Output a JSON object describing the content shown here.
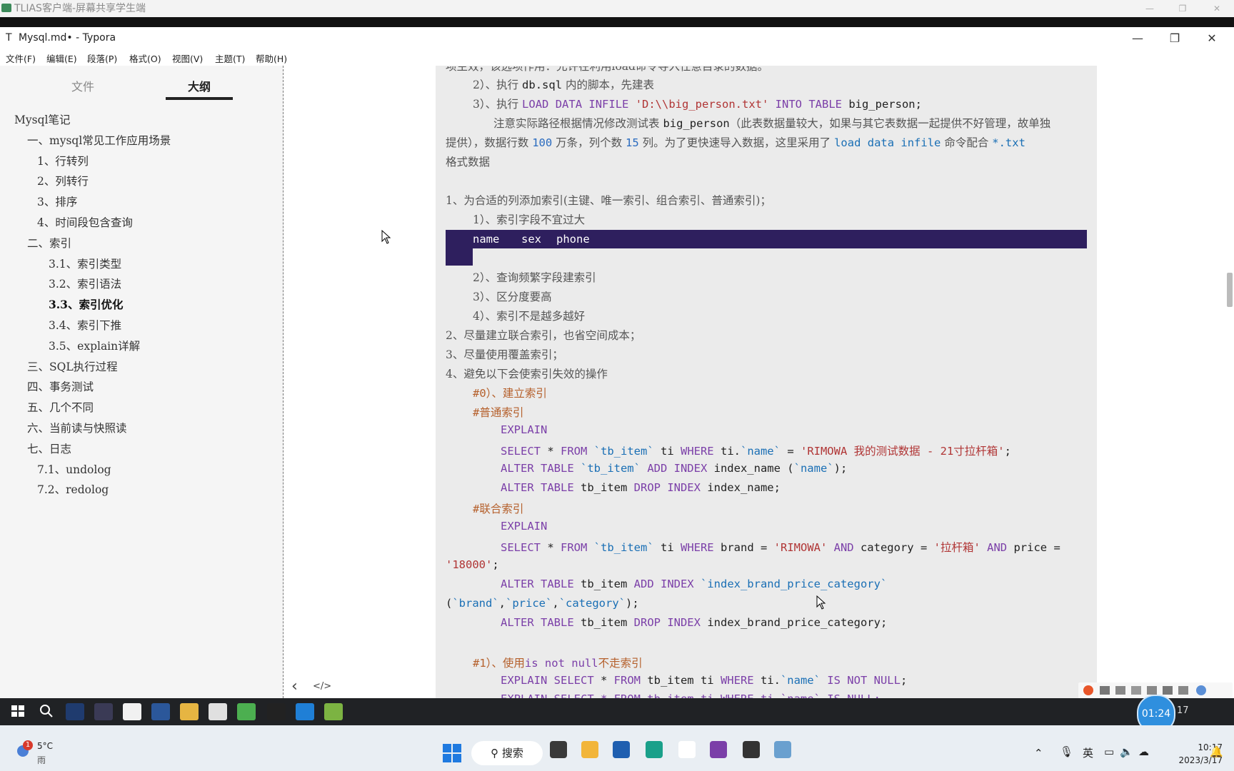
{
  "outer_window": {
    "title": "TLIAS客户端-屏幕共享学生端",
    "controls": [
      "—",
      "❐",
      "✕"
    ]
  },
  "typora": {
    "icon_letter": "T",
    "title": "Mysql.md• - Typora",
    "window_controls": [
      "—",
      "❐",
      "✕"
    ],
    "menu": [
      "文件(F)",
      "编辑(E)",
      "段落(P)",
      "格式(O)",
      "视图(V)",
      "主题(T)",
      "帮助(H)"
    ]
  },
  "sidebar": {
    "tabs": [
      "文件",
      "大纲"
    ],
    "active_tab": "大纲",
    "outline": [
      {
        "text": "Mysql笔记",
        "level": 0
      },
      {
        "text": "一、mysql常见工作应用场景",
        "level": 1
      },
      {
        "text": "1、行转列",
        "level": 2
      },
      {
        "text": "2、列转行",
        "level": 2
      },
      {
        "text": "3、排序",
        "level": 2
      },
      {
        "text": "4、时间段包含查询",
        "level": 2
      },
      {
        "text": "二、索引",
        "level": 1
      },
      {
        "text": "3.1、索引类型",
        "level": 3
      },
      {
        "text": "3.2、索引语法",
        "level": 3
      },
      {
        "text": "3.3、索引优化",
        "level": 3,
        "active": true
      },
      {
        "text": "3.4、索引下推",
        "level": 3
      },
      {
        "text": "3.5、explain详解",
        "level": 3
      },
      {
        "text": "三、SQL执行过程",
        "level": 1
      },
      {
        "text": "四、事务测试",
        "level": 1
      },
      {
        "text": "五、几个不同",
        "level": 1
      },
      {
        "text": "六、当前读与快照读",
        "level": 1
      },
      {
        "text": "七、日志",
        "level": 1
      },
      {
        "text": "7.1、undolog",
        "level": 2
      },
      {
        "text": "7.2、redolog",
        "level": 2
      }
    ]
  },
  "editor": {
    "line0": "项主效，该选项作用：允许在利用load命令导入任意目录的数据。",
    "l1_a": "2）、执行 ",
    "l1_b": "db.sql",
    "l1_c": " 内的脚本，先建表",
    "l2_a": "3）、执行 ",
    "l2_b": "LOAD DATA INFILE ",
    "l2_c": "'D:\\\\big_person.txt'",
    "l2_d": " INTO TABLE ",
    "l2_e": "big_person;",
    "l3_a": "注意实际路径根据情况修改测试表 ",
    "l3_b": "big_person",
    "l3_c": "（此表数据量较大，如果与其它表数据一起提供不好管理，故单独",
    "l4_a": "提供），数据行数 ",
    "l4_b": "100",
    "l4_c": " 万条，列个数 ",
    "l4_d": "15",
    "l4_e": " 列。为了更快速导入数据，这里采用了 ",
    "l4_f": "load data infile",
    "l4_g": " 命令配合 ",
    "l4_h": "*.txt",
    "l5": "格式数据",
    "l6": "1、为合适的列添加索引(主键、唯一索引、组合索引、普通索引)；",
    "l7": "1）、索引字段不宜过大",
    "sel": [
      "name",
      "sex",
      "phone"
    ],
    "l8": "2）、查询频繁字段建索引",
    "l9": "3）、区分度要高",
    "l10": "4）、索引不是越多越好",
    "l11": "2、尽量建立联合索引，也省空间成本；",
    "l12": "3、尽量使用覆盖索引；",
    "l13": "4、避免以下会使索引失效的操作",
    "l14": "#0）、建立索引",
    "l15": "#普通索引",
    "l16": "EXPLAIN",
    "l17_a": "SELECT",
    "l17_b": " * ",
    "l17_c": "FROM",
    "l17_d": " `tb_item` ",
    "l17_e": "ti ",
    "l17_f": "WHERE",
    "l17_g": " ti.",
    "l17_h": "`name`",
    "l17_i": " = ",
    "l17_j": "'RIMOWA 我的测试数据 - 21寸拉杆箱'",
    "l17_k": ";",
    "l18_a": "ALTER TABLE",
    "l18_b": " `tb_item` ",
    "l18_c": "ADD INDEX",
    "l18_d": " index_name (",
    "l18_e": "`name`",
    "l18_f": ");",
    "l19_a": "ALTER TABLE",
    "l19_b": " tb_item ",
    "l19_c": "DROP INDEX",
    "l19_d": " index_name;",
    "l20": "#联合索引",
    "l21": "EXPLAIN",
    "l22_a": "SELECT",
    "l22_b": " * ",
    "l22_c": "FROM",
    "l22_d": " `tb_item` ",
    "l22_e": "ti ",
    "l22_f": "WHERE",
    "l22_g": " brand = ",
    "l22_h": "'RIMOWA'",
    "l22_i": " AND",
    "l22_j": " category = ",
    "l22_k": "'拉杆箱'",
    "l22_l": " AND",
    "l22_m": " price =",
    "l23_a": "'18000'",
    "l23_b": ";",
    "l24_a": "ALTER TABLE",
    "l24_b": " tb_item ",
    "l24_c": "ADD INDEX",
    "l24_d": " `index_brand_price_category`",
    "l25_a": "(",
    "l25_b": "`brand`",
    "l25_c": ",",
    "l25_d": "`price`",
    "l25_e": ",",
    "l25_f": "`category`",
    "l25_g": ");",
    "l26_a": "ALTER TABLE",
    "l26_b": " tb_item ",
    "l26_c": "DROP INDEX",
    "l26_d": " index_brand_price_category;",
    "l27_a": "#1）、使用",
    "l27_b": "is not null",
    "l27_c": "不走索引",
    "l28_a": "EXPLAIN SELECT",
    "l28_b": " * ",
    "l28_c": "FROM",
    "l28_d": " tb_item ti ",
    "l28_e": "WHERE",
    "l28_f": " ti.",
    "l28_g": "`name`",
    "l28_h": " IS NOT NULL",
    "l28_i": ";",
    "l29": "EXPLAIN SELECT * FROM tb_item ti WHERE ti.`name` IS NULL;"
  },
  "editor_footer": {
    "back": "‹",
    "source": "</>"
  },
  "inner_taskbar": {
    "icons": [
      "windows-logo",
      "search",
      "intellij",
      "git",
      "typora",
      "word",
      "explorer",
      "obs",
      "chrome",
      "typora-dark",
      "edge",
      "notepad"
    ],
    "timer": "01:24",
    "timer_suffix": "17"
  },
  "outer_taskbar": {
    "weather_temp": "5°C",
    "weather_desc": "雨",
    "weather_badge": "1",
    "search_label": "搜索",
    "lang": "英",
    "time": "10:17",
    "date": "2023/3/17"
  }
}
